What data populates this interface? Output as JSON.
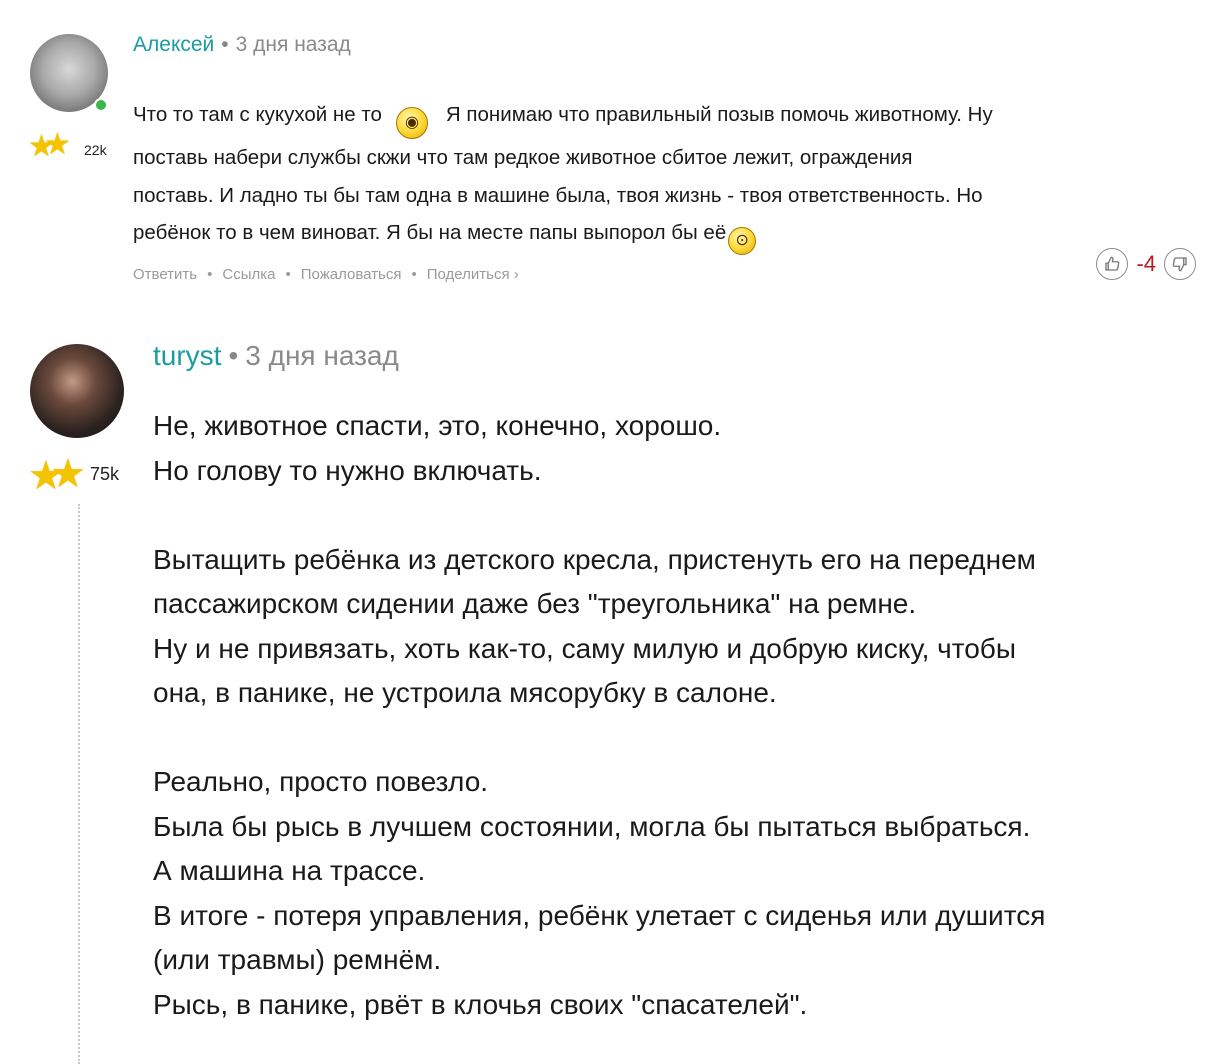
{
  "comments": [
    {
      "author": "Алексей",
      "time": "3 дня назад",
      "rating": "22k",
      "online": true,
      "lines": [
        "Что то там с кукухой не то",
        "Я понимаю что правильный позыв помочь животному. Ну",
        "поставь набери службы скжи что там редкое животное сбитое лежит, ограждения",
        "поставь. И ладно ты бы там одна в машине была, твоя жизнь - твоя ответственность. Но",
        "ребёнок то в чем виноват. Я бы на месте папы выпорол бы её"
      ],
      "emojis": [
        "crazy-emoji",
        "shocked-emoji"
      ],
      "actions": [
        "Ответить",
        "Ссылка",
        "Пожаловаться",
        "Поделиться ›"
      ],
      "score": "-4",
      "icons": {
        "like": "thumbs-up-icon",
        "dislike": "thumbs-down-icon",
        "star": "star-icon"
      }
    },
    {
      "author": "turyst",
      "time": "3 дня назад",
      "rating": "75k",
      "lines": [
        "Не, животное спасти, это, конечно, хорошо.",
        "Но голову то нужно включать.",
        "",
        "Вытащить ребёнка из детского кресла, пристенуть его на переднем",
        "пассажирском сидении даже без \"треугольника\" на ремне.",
        "Ну и не привязать, хоть как-то, саму милую и добрую киску, чтобы",
        "она, в панике, не устроила мясорубку в салоне.",
        "",
        "Реально, просто повезло.",
        "Была бы рысь в лучшем состоянии, могла бы пытаться выбраться.",
        "А машина на трассе.",
        "В итоге - потеря управления, ребёнк улетает с сиденья или душится",
        "(или травмы) ремнём.",
        "Рысь, в панике, рвёт в клочья своих \"спасателей\"."
      ]
    }
  ],
  "colors": {
    "author": "#1a9ca0",
    "time": "#8a8a8a",
    "negative_score": "#c0161f",
    "star": "#f5c400",
    "online": "#3cb54a"
  }
}
